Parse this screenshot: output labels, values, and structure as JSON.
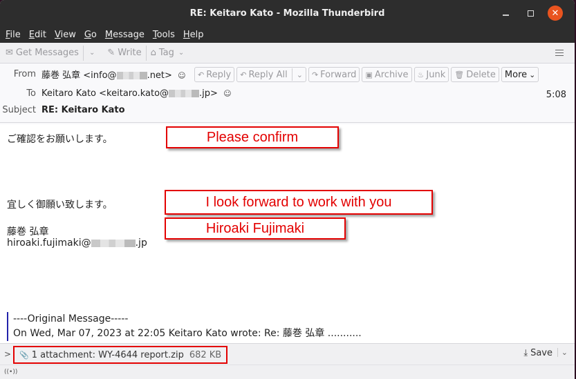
{
  "window": {
    "title": "RE: Keitaro Kato - Mozilla Thunderbird",
    "controls": {
      "minimize": "minimize-icon",
      "maximize": "maximize-icon",
      "close": "close-icon",
      "close_glyph": "✕"
    }
  },
  "menubar": {
    "items": [
      {
        "mnemonic": "F",
        "rest": "ile"
      },
      {
        "mnemonic": "E",
        "rest": "dit"
      },
      {
        "mnemonic": "V",
        "rest": "iew"
      },
      {
        "mnemonic": "G",
        "rest": "o"
      },
      {
        "mnemonic": "M",
        "rest": "essage"
      },
      {
        "mnemonic": "T",
        "rest": "ools"
      },
      {
        "mnemonic": "H",
        "rest": "elp"
      }
    ]
  },
  "toolbar": {
    "get_messages": "Get Messages",
    "write": "Write",
    "tag": "Tag",
    "icons": {
      "get_messages": "✉",
      "write": "✎",
      "tag": "⌂",
      "chevron": "⌄"
    }
  },
  "header": {
    "from_label": "From",
    "from_name": "藤巻 弘章",
    "from_email_prefix": "<info@",
    "from_email_suffix": ".net>",
    "to_label": "To",
    "to_name": "Keitaro Kato",
    "to_email_prefix": "<keitaro.kato@",
    "to_email_suffix": ".jp>",
    "subject_label": "Subject",
    "subject": "RE: Keitaro Kato",
    "time": "5:08",
    "contact_icon": "☺",
    "buttons": {
      "reply": "Reply",
      "reply_all": "Reply All",
      "forward": "Forward",
      "archive": "Archive",
      "junk": "Junk",
      "delete": "Delete",
      "more": "More"
    },
    "button_icons": {
      "reply": "↶",
      "reply_all": "↶",
      "forward": "↷",
      "archive": "▣",
      "junk": "♨",
      "delete": "🗑",
      "chevron": "⌄"
    }
  },
  "body": {
    "line1": "ご確認をお願いします。",
    "line2": "宜しく御願い致します。",
    "signature_name": "藤巻 弘章",
    "signature_email_prefix": "hiroaki.fujimaki@",
    "signature_email_suffix": ".jp",
    "quote_header": "----Original Message-----",
    "quote_line": "On Wed, Mar 07, 2023 at 22:05 Keitaro Kato wrote: Re: 藤巻 弘章 ..........."
  },
  "annotations": {
    "please_confirm": "Please confirm",
    "look_forward": "I look forward to work with you",
    "name": "Hiroaki Fujimaki",
    "color": "#e30000"
  },
  "attachment": {
    "toggle": ">",
    "icon": "📎",
    "label": "1 attachment: WY-4644 report.zip",
    "size": "682 KB",
    "save": "Save",
    "save_icon": "⤓",
    "chevron": "⌄"
  },
  "statusbar": {
    "activity_icon": "((•))"
  }
}
